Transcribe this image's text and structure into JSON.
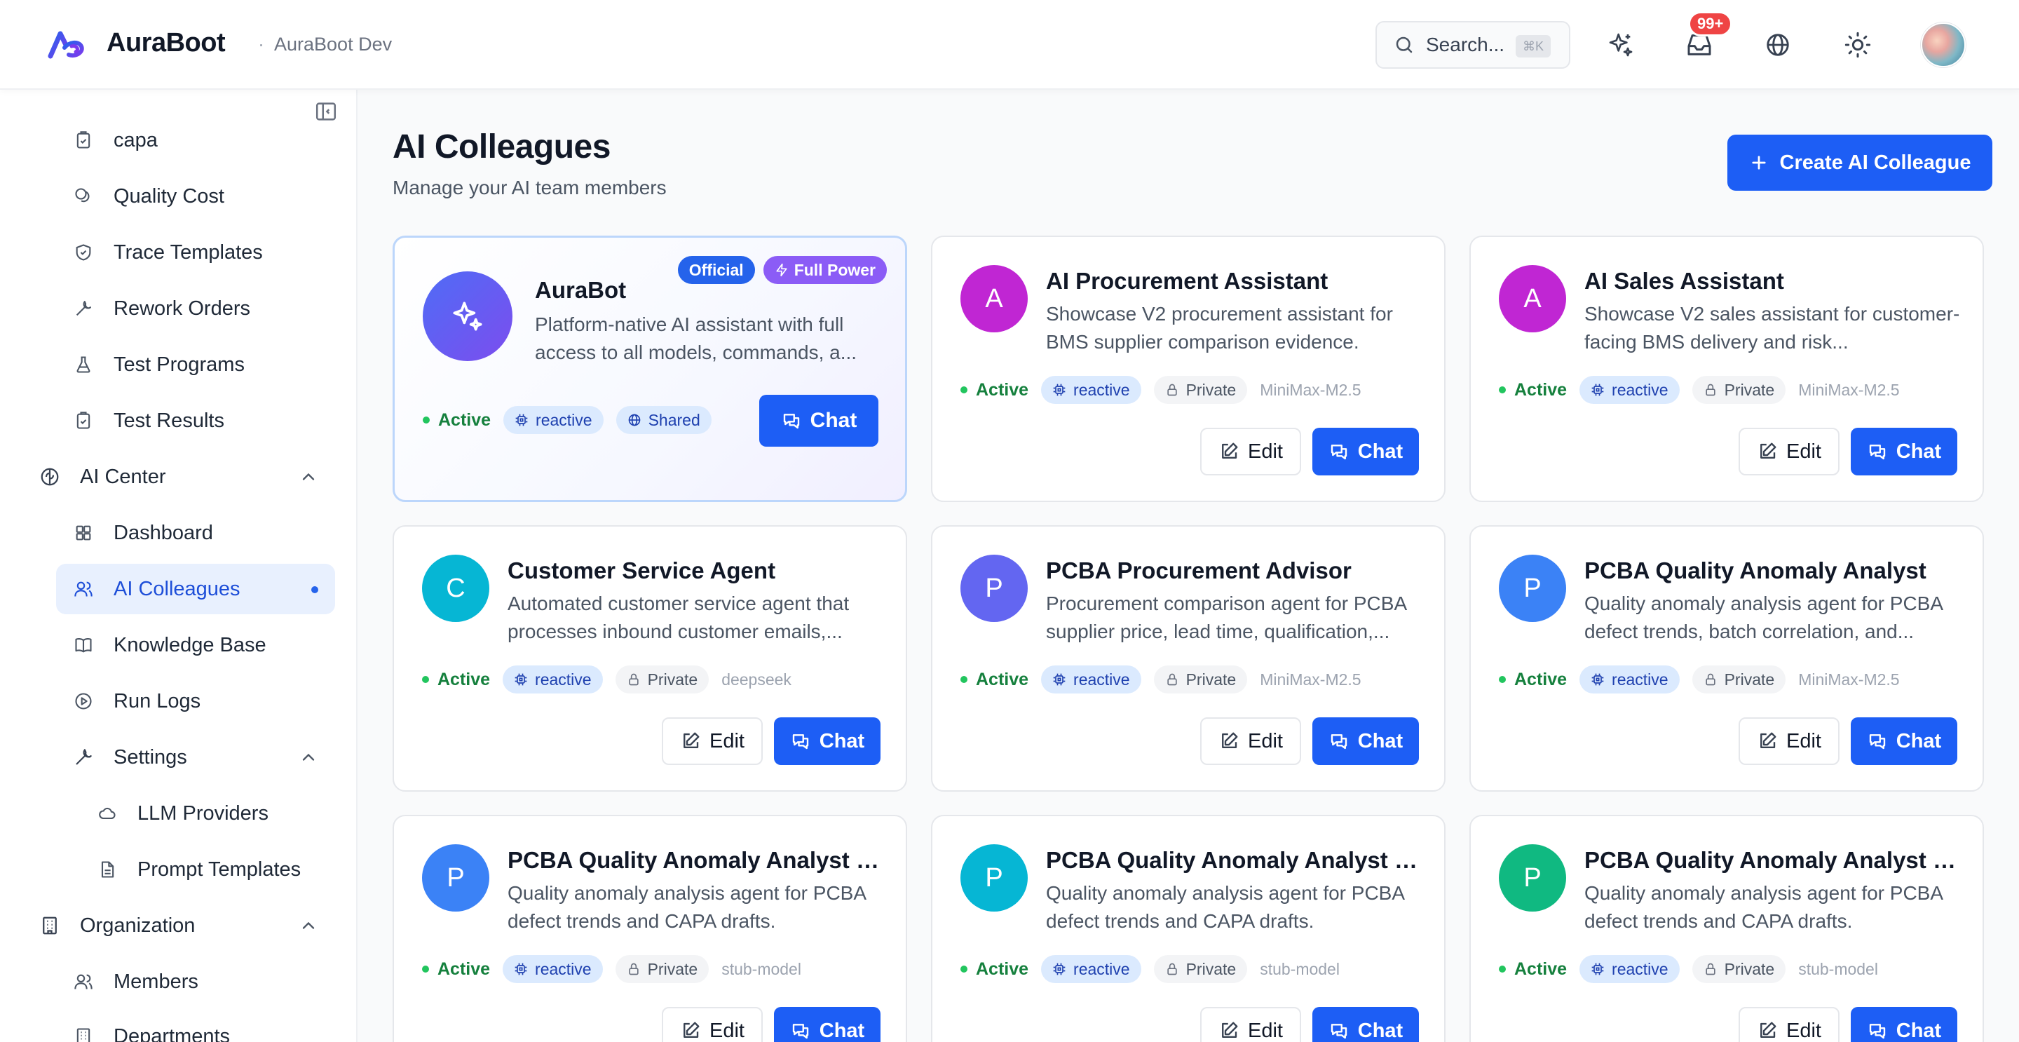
{
  "header": {
    "brand": "AuraBoot",
    "workspace": "AuraBoot Dev",
    "search_label": "Search...",
    "search_kbd": "⌘K",
    "notif_count": "99+"
  },
  "sidebar": {
    "items": [
      {
        "label": "capa",
        "icon": "clipboard-check-icon"
      },
      {
        "label": "Quality Cost",
        "icon": "coins-icon"
      },
      {
        "label": "Trace Templates",
        "icon": "shield-check-icon"
      },
      {
        "label": "Rework Orders",
        "icon": "wrench-icon"
      },
      {
        "label": "Test Programs",
        "icon": "flask-icon"
      },
      {
        "label": "Test Results",
        "icon": "clipboard-check-icon"
      },
      {
        "label": "AI Center",
        "icon": "brain-icon",
        "expanded": true
      },
      {
        "label": "Dashboard",
        "icon": "grid-icon"
      },
      {
        "label": "AI Colleagues",
        "icon": "users-icon",
        "active": true
      },
      {
        "label": "Knowledge Base",
        "icon": "book-icon"
      },
      {
        "label": "Run Logs",
        "icon": "play-circle-icon"
      },
      {
        "label": "Settings",
        "icon": "wrench-icon",
        "expanded": true
      },
      {
        "label": "LLM Providers",
        "icon": "cloud-icon"
      },
      {
        "label": "Prompt Templates",
        "icon": "file-text-icon"
      },
      {
        "label": "Organization",
        "icon": "building-icon",
        "expanded": true
      },
      {
        "label": "Members",
        "icon": "users-icon"
      },
      {
        "label": "Departments",
        "icon": "building-icon"
      }
    ]
  },
  "main": {
    "title": "AI Colleagues",
    "subtitle": "Manage your AI team members",
    "create_label": "Create AI Colleague",
    "edit_label": "Edit",
    "chat_label": "Chat",
    "status_label": "Active",
    "mode_label": "reactive",
    "cards": [
      {
        "initial": "",
        "name": "AuraBot",
        "desc": "Platform-native AI assistant with full access to all models, commands, a...",
        "visibility": "Shared",
        "model": "",
        "featured": true,
        "badge_official": "Official",
        "badge_power": "Full Power"
      },
      {
        "initial": "A",
        "name": "AI Procurement Assistant",
        "desc": "Showcase V2 procurement assistant for BMS supplier comparison evidence.",
        "visibility": "Private",
        "model": "MiniMax-M2.5",
        "color": "#c026d3"
      },
      {
        "initial": "A",
        "name": "AI Sales Assistant",
        "desc": "Showcase V2 sales assistant for customer-facing BMS delivery and risk...",
        "visibility": "Private",
        "model": "MiniMax-M2.5",
        "color": "#c026d3"
      },
      {
        "initial": "C",
        "name": "Customer Service Agent",
        "desc": "Automated customer service agent that processes inbound customer emails,...",
        "visibility": "Private",
        "model": "deepseek",
        "color": "#06b6d4"
      },
      {
        "initial": "P",
        "name": "PCBA Procurement Advisor",
        "desc": "Procurement comparison agent for PCBA supplier price, lead time, qualification,...",
        "visibility": "Private",
        "model": "MiniMax-M2.5",
        "color": "#6366f1"
      },
      {
        "initial": "P",
        "name": "PCBA Quality Anomaly Analyst",
        "desc": "Quality anomaly analysis agent for PCBA defect trends, batch correlation, and...",
        "visibility": "Private",
        "model": "MiniMax-M2.5",
        "color": "#3b82f6"
      },
      {
        "initial": "P",
        "name": "PCBA Quality Anomaly Analyst E...",
        "desc": "Quality anomaly analysis agent for PCBA defect trends and CAPA drafts.",
        "visibility": "Private",
        "model": "stub-model",
        "color": "#3b82f6"
      },
      {
        "initial": "P",
        "name": "PCBA Quality Anomaly Analyst E...",
        "desc": "Quality anomaly analysis agent for PCBA defect trends and CAPA drafts.",
        "visibility": "Private",
        "model": "stub-model",
        "color": "#06b6d4"
      },
      {
        "initial": "P",
        "name": "PCBA Quality Anomaly Analyst E...",
        "desc": "Quality anomaly analysis agent for PCBA defect trends and CAPA drafts.",
        "visibility": "Private",
        "model": "stub-model",
        "color": "#10b981"
      }
    ]
  },
  "colors": {
    "accent": "#1d5ef5",
    "active_green": "#22c55e",
    "badge_red": "#ef4444",
    "full_power": "#8b5cf6"
  }
}
